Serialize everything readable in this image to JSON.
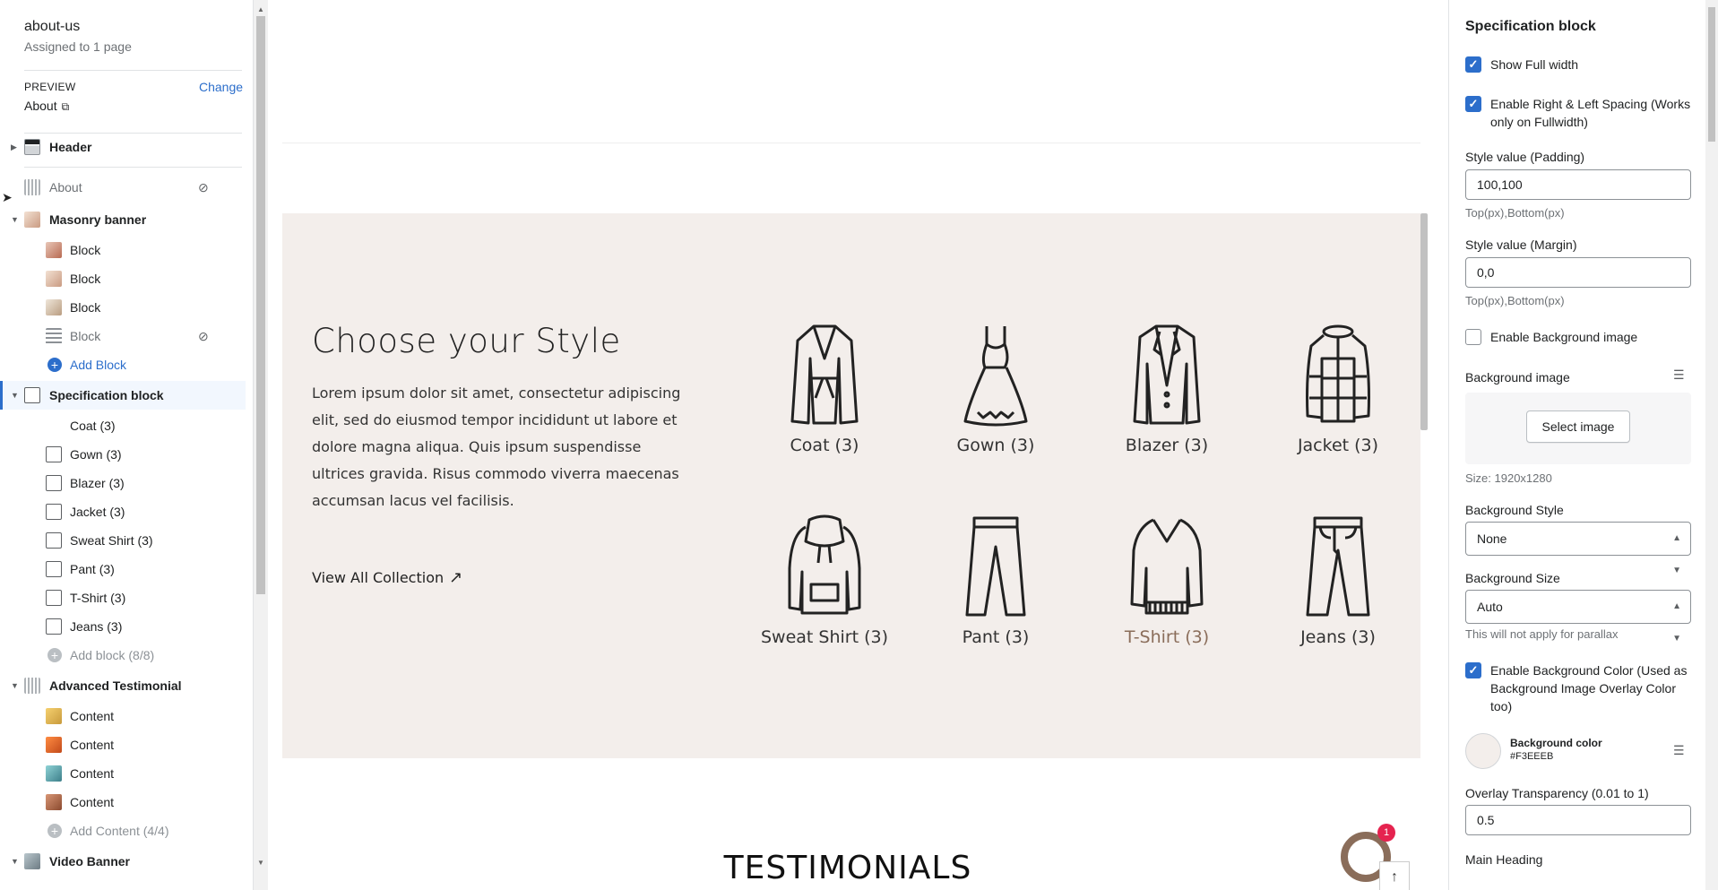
{
  "template": {
    "name": "about-us",
    "assigned": "Assigned to 1 page"
  },
  "preview": {
    "label": "PREVIEW",
    "change": "Change",
    "page": "About"
  },
  "sections": [
    {
      "label": "Header"
    },
    {
      "label": "About"
    },
    {
      "label": "Masonry banner",
      "blocks": [
        "Block",
        "Block",
        "Block",
        "Block"
      ],
      "add": "Add Block"
    },
    {
      "label": "Specification block",
      "blocks": [
        "Coat (3)",
        "Gown (3)",
        "Blazer (3)",
        "Jacket (3)",
        "Sweat Shirt (3)",
        "Pant (3)",
        "T-Shirt (3)",
        "Jeans (3)"
      ],
      "add": "Add block (8/8)"
    },
    {
      "label": "Advanced Testimonial",
      "blocks": [
        "Content",
        "Content",
        "Content",
        "Content"
      ],
      "add": "Add Content (4/4)"
    },
    {
      "label": "Video Banner"
    }
  ],
  "canvas": {
    "title": "Choose your Style",
    "description": "Lorem ipsum dolor sit amet, consectetur adipiscing elit, sed do eiusmod tempor incididunt ut labore et dolore magna aliqua. Quis ipsum suspendisse ultrices gravida. Risus commodo viverra maecenas accumsan lacus vel facilisis.",
    "link": "View All Collection",
    "categories": [
      "Coat (3)",
      "Gown (3)",
      "Blazer (3)",
      "Jacket (3)",
      "Sweat Shirt (3)",
      "Pant (3)",
      "T-Shirt (3)",
      "Jeans (3)"
    ],
    "testimonials_heading": "TESTIMONIALS",
    "chat_badge": "1",
    "highlight_color": "#8a6d5a",
    "background_color": "#F3EEEB"
  },
  "settings": {
    "title": "Specification block",
    "show_full_width": "Show Full width",
    "enable_spacing": "Enable Right & Left Spacing (Works only on Fullwidth)",
    "padding_label": "Style value (Padding)",
    "padding_value": "100,100",
    "padding_help": "Top(px),Bottom(px)",
    "margin_label": "Style value (Margin)",
    "margin_value": "0,0",
    "margin_help": "Top(px),Bottom(px)",
    "enable_bg_image": "Enable Background image",
    "bg_image_label": "Background image",
    "select_image": "Select image",
    "size_note": "Size: 1920x1280",
    "bg_style_label": "Background Style",
    "bg_style_value": "None",
    "bg_size_label": "Background Size",
    "bg_size_value": "Auto",
    "bg_size_help": "This will not apply for parallax",
    "enable_bg_color": "Enable Background Color (Used as Background Image Overlay Color too)",
    "bg_color_label": "Background color",
    "bg_color_value": "#F3EEEB",
    "overlay_label": "Overlay Transparency (0.01 to 1)",
    "overlay_value": "0.5",
    "main_heading_label": "Main Heading"
  }
}
